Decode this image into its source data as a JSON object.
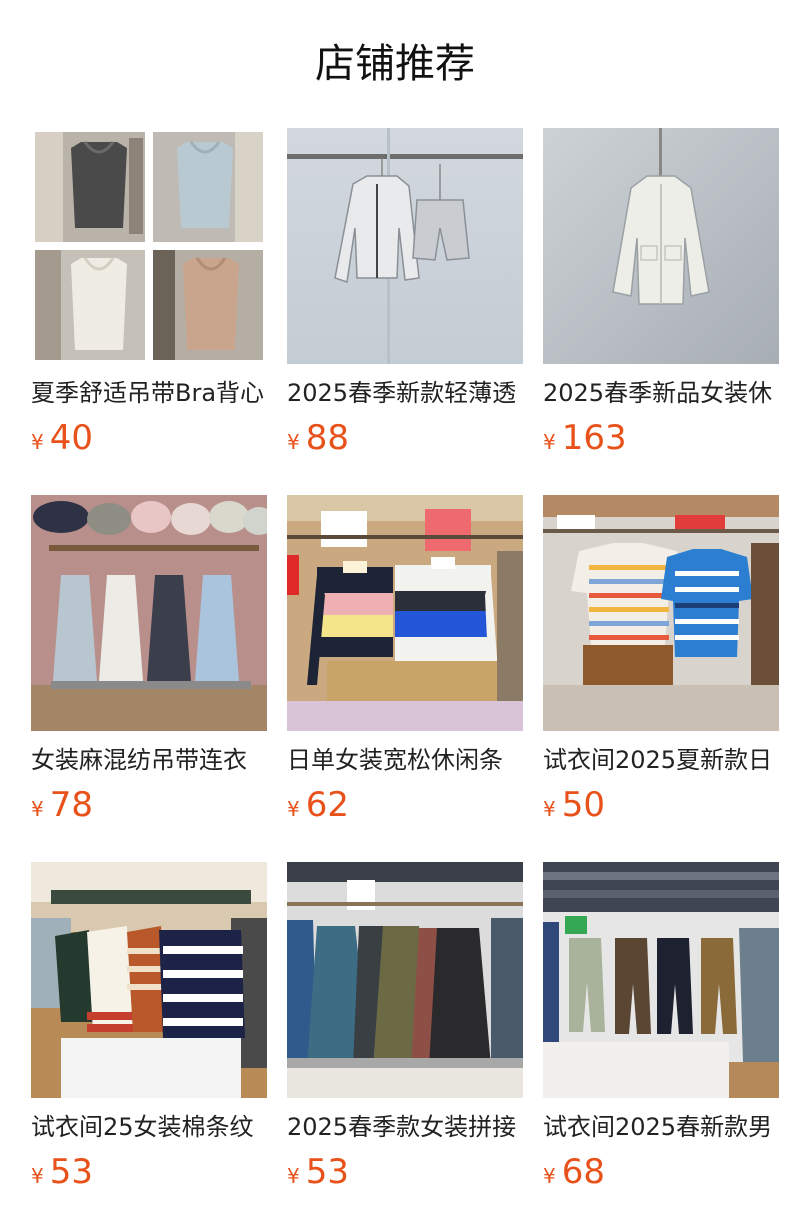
{
  "section_title": "店铺推荐",
  "currency_symbol": "¥",
  "products": [
    {
      "name": "夏季舒适吊带Bra背心",
      "price": "40",
      "thumb_icon": "tank-tops-photo"
    },
    {
      "name": "2025春季新款轻薄透",
      "price": "88",
      "thumb_icon": "jacket-shorts-photo"
    },
    {
      "name": "2025春季新品女装休",
      "price": "163",
      "thumb_icon": "white-jacket-photo"
    },
    {
      "name": "女装麻混纺吊带连衣",
      "price": "78",
      "thumb_icon": "strap-dresses-photo"
    },
    {
      "name": "日单女装宽松休闲条",
      "price": "62",
      "thumb_icon": "striped-polo-photo"
    },
    {
      "name": "试衣间2025夏新款日",
      "price": "50",
      "thumb_icon": "striped-tees-photo"
    },
    {
      "name": "试衣间25女装棉条纹",
      "price": "53",
      "thumb_icon": "striped-knits-photo"
    },
    {
      "name": "2025春季款女装拼接",
      "price": "53",
      "thumb_icon": "long-dresses-photo"
    },
    {
      "name": "试衣间2025春新款男",
      "price": "68",
      "thumb_icon": "cargo-pants-photo"
    }
  ]
}
